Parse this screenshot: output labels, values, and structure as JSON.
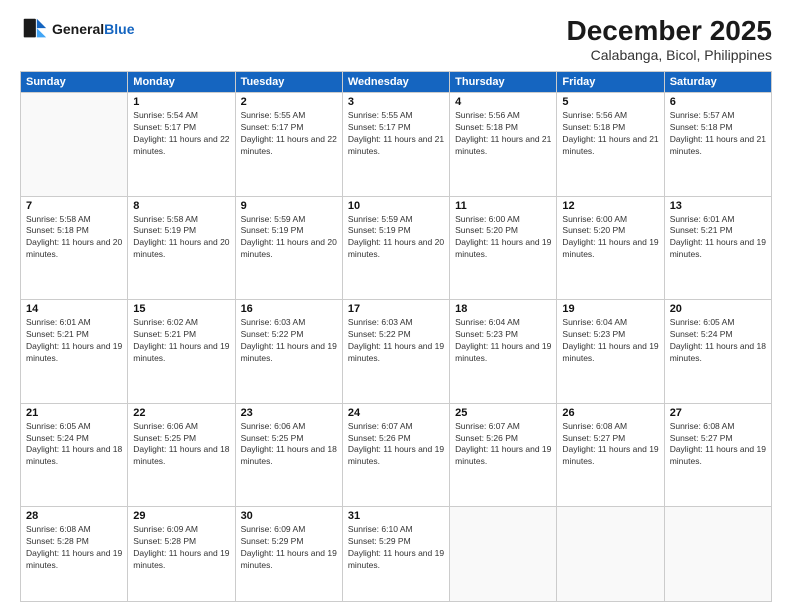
{
  "header": {
    "logo_line1": "General",
    "logo_line2": "Blue",
    "month": "December 2025",
    "location": "Calabanga, Bicol, Philippines"
  },
  "weekdays": [
    "Sunday",
    "Monday",
    "Tuesday",
    "Wednesday",
    "Thursday",
    "Friday",
    "Saturday"
  ],
  "weeks": [
    [
      {
        "day": "",
        "sunrise": "",
        "sunset": "",
        "daylight": ""
      },
      {
        "day": "1",
        "sunrise": "Sunrise: 5:54 AM",
        "sunset": "Sunset: 5:17 PM",
        "daylight": "Daylight: 11 hours and 22 minutes."
      },
      {
        "day": "2",
        "sunrise": "Sunrise: 5:55 AM",
        "sunset": "Sunset: 5:17 PM",
        "daylight": "Daylight: 11 hours and 22 minutes."
      },
      {
        "day": "3",
        "sunrise": "Sunrise: 5:55 AM",
        "sunset": "Sunset: 5:17 PM",
        "daylight": "Daylight: 11 hours and 21 minutes."
      },
      {
        "day": "4",
        "sunrise": "Sunrise: 5:56 AM",
        "sunset": "Sunset: 5:18 PM",
        "daylight": "Daylight: 11 hours and 21 minutes."
      },
      {
        "day": "5",
        "sunrise": "Sunrise: 5:56 AM",
        "sunset": "Sunset: 5:18 PM",
        "daylight": "Daylight: 11 hours and 21 minutes."
      },
      {
        "day": "6",
        "sunrise": "Sunrise: 5:57 AM",
        "sunset": "Sunset: 5:18 PM",
        "daylight": "Daylight: 11 hours and 21 minutes."
      }
    ],
    [
      {
        "day": "7",
        "sunrise": "Sunrise: 5:58 AM",
        "sunset": "Sunset: 5:18 PM",
        "daylight": "Daylight: 11 hours and 20 minutes."
      },
      {
        "day": "8",
        "sunrise": "Sunrise: 5:58 AM",
        "sunset": "Sunset: 5:19 PM",
        "daylight": "Daylight: 11 hours and 20 minutes."
      },
      {
        "day": "9",
        "sunrise": "Sunrise: 5:59 AM",
        "sunset": "Sunset: 5:19 PM",
        "daylight": "Daylight: 11 hours and 20 minutes."
      },
      {
        "day": "10",
        "sunrise": "Sunrise: 5:59 AM",
        "sunset": "Sunset: 5:19 PM",
        "daylight": "Daylight: 11 hours and 20 minutes."
      },
      {
        "day": "11",
        "sunrise": "Sunrise: 6:00 AM",
        "sunset": "Sunset: 5:20 PM",
        "daylight": "Daylight: 11 hours and 19 minutes."
      },
      {
        "day": "12",
        "sunrise": "Sunrise: 6:00 AM",
        "sunset": "Sunset: 5:20 PM",
        "daylight": "Daylight: 11 hours and 19 minutes."
      },
      {
        "day": "13",
        "sunrise": "Sunrise: 6:01 AM",
        "sunset": "Sunset: 5:21 PM",
        "daylight": "Daylight: 11 hours and 19 minutes."
      }
    ],
    [
      {
        "day": "14",
        "sunrise": "Sunrise: 6:01 AM",
        "sunset": "Sunset: 5:21 PM",
        "daylight": "Daylight: 11 hours and 19 minutes."
      },
      {
        "day": "15",
        "sunrise": "Sunrise: 6:02 AM",
        "sunset": "Sunset: 5:21 PM",
        "daylight": "Daylight: 11 hours and 19 minutes."
      },
      {
        "day": "16",
        "sunrise": "Sunrise: 6:03 AM",
        "sunset": "Sunset: 5:22 PM",
        "daylight": "Daylight: 11 hours and 19 minutes."
      },
      {
        "day": "17",
        "sunrise": "Sunrise: 6:03 AM",
        "sunset": "Sunset: 5:22 PM",
        "daylight": "Daylight: 11 hours and 19 minutes."
      },
      {
        "day": "18",
        "sunrise": "Sunrise: 6:04 AM",
        "sunset": "Sunset: 5:23 PM",
        "daylight": "Daylight: 11 hours and 19 minutes."
      },
      {
        "day": "19",
        "sunrise": "Sunrise: 6:04 AM",
        "sunset": "Sunset: 5:23 PM",
        "daylight": "Daylight: 11 hours and 19 minutes."
      },
      {
        "day": "20",
        "sunrise": "Sunrise: 6:05 AM",
        "sunset": "Sunset: 5:24 PM",
        "daylight": "Daylight: 11 hours and 18 minutes."
      }
    ],
    [
      {
        "day": "21",
        "sunrise": "Sunrise: 6:05 AM",
        "sunset": "Sunset: 5:24 PM",
        "daylight": "Daylight: 11 hours and 18 minutes."
      },
      {
        "day": "22",
        "sunrise": "Sunrise: 6:06 AM",
        "sunset": "Sunset: 5:25 PM",
        "daylight": "Daylight: 11 hours and 18 minutes."
      },
      {
        "day": "23",
        "sunrise": "Sunrise: 6:06 AM",
        "sunset": "Sunset: 5:25 PM",
        "daylight": "Daylight: 11 hours and 18 minutes."
      },
      {
        "day": "24",
        "sunrise": "Sunrise: 6:07 AM",
        "sunset": "Sunset: 5:26 PM",
        "daylight": "Daylight: 11 hours and 19 minutes."
      },
      {
        "day": "25",
        "sunrise": "Sunrise: 6:07 AM",
        "sunset": "Sunset: 5:26 PM",
        "daylight": "Daylight: 11 hours and 19 minutes."
      },
      {
        "day": "26",
        "sunrise": "Sunrise: 6:08 AM",
        "sunset": "Sunset: 5:27 PM",
        "daylight": "Daylight: 11 hours and 19 minutes."
      },
      {
        "day": "27",
        "sunrise": "Sunrise: 6:08 AM",
        "sunset": "Sunset: 5:27 PM",
        "daylight": "Daylight: 11 hours and 19 minutes."
      }
    ],
    [
      {
        "day": "28",
        "sunrise": "Sunrise: 6:08 AM",
        "sunset": "Sunset: 5:28 PM",
        "daylight": "Daylight: 11 hours and 19 minutes."
      },
      {
        "day": "29",
        "sunrise": "Sunrise: 6:09 AM",
        "sunset": "Sunset: 5:28 PM",
        "daylight": "Daylight: 11 hours and 19 minutes."
      },
      {
        "day": "30",
        "sunrise": "Sunrise: 6:09 AM",
        "sunset": "Sunset: 5:29 PM",
        "daylight": "Daylight: 11 hours and 19 minutes."
      },
      {
        "day": "31",
        "sunrise": "Sunrise: 6:10 AM",
        "sunset": "Sunset: 5:29 PM",
        "daylight": "Daylight: 11 hours and 19 minutes."
      },
      {
        "day": "",
        "sunrise": "",
        "sunset": "",
        "daylight": ""
      },
      {
        "day": "",
        "sunrise": "",
        "sunset": "",
        "daylight": ""
      },
      {
        "day": "",
        "sunrise": "",
        "sunset": "",
        "daylight": ""
      }
    ]
  ]
}
